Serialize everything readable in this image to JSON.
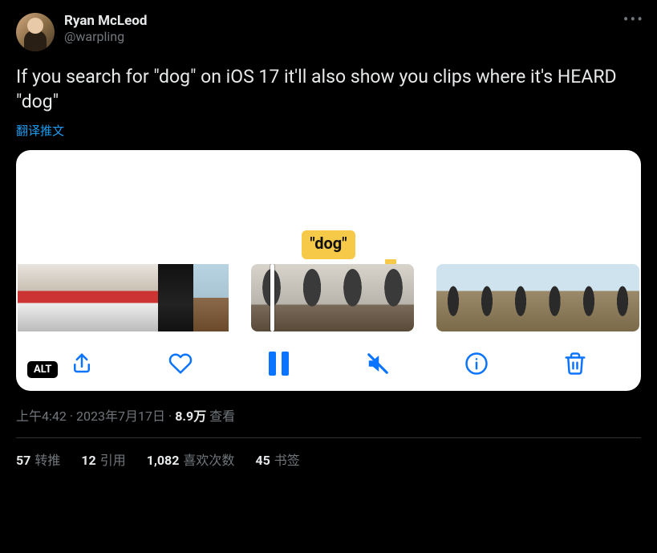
{
  "user": {
    "display_name": "Ryan McLeod",
    "handle": "@warpling"
  },
  "more_label": "•••",
  "tweet_text": "If you search for \"dog\" on iOS 17 it'll also show you clips where it's HEARD \"dog\"",
  "translate_label": "翻译推文",
  "media": {
    "search_tag": "\"dog\"",
    "alt_badge": "ALT",
    "toolbar_icons": {
      "share": "share-icon",
      "like": "heart-icon",
      "pause": "pause-icon",
      "mute": "speaker-muted-icon",
      "info": "info-icon",
      "trash": "trash-icon"
    }
  },
  "meta": {
    "time": "上午4:42",
    "date": "2023年7月17日",
    "views_count": "8.9万",
    "views_label": "查看"
  },
  "stats": {
    "retweets_count": "57",
    "retweets_label": "转推",
    "quotes_count": "12",
    "quotes_label": "引用",
    "likes_count": "1,082",
    "likes_label": "喜欢次数",
    "bookmarks_count": "45",
    "bookmarks_label": "书签"
  }
}
